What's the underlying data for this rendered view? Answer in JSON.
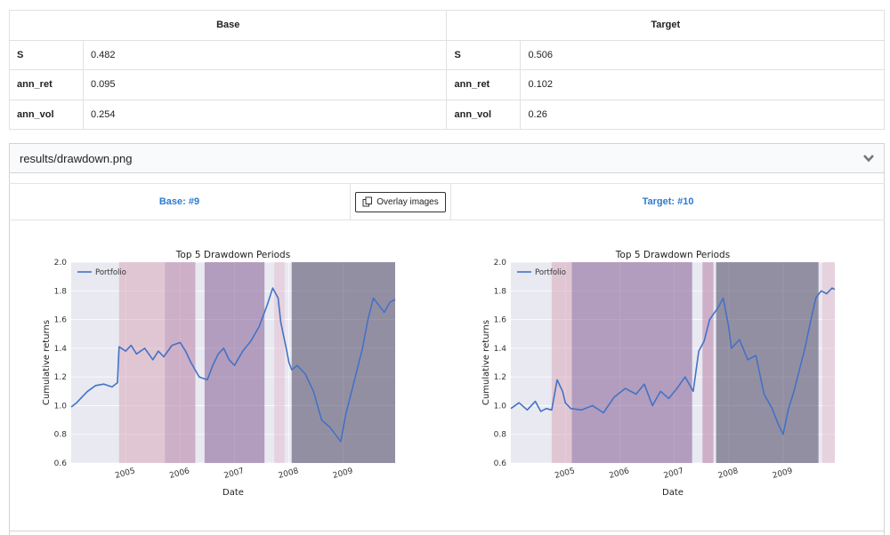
{
  "table": {
    "headers": {
      "base": "Base",
      "target": "Target"
    },
    "rows": [
      {
        "key": "S",
        "base": "0.482",
        "target": "0.506"
      },
      {
        "key": "ann_ret",
        "base": "0.095",
        "target": "0.102"
      },
      {
        "key": "ann_vol",
        "base": "0.254",
        "target": "0.26"
      }
    ]
  },
  "section": {
    "title": "results/drawdown.png",
    "base_label": "Base: #9",
    "target_label": "Target: #10",
    "overlay_button": "Overlay images",
    "link_color": "#2b7bd0"
  },
  "chart_data": [
    {
      "type": "line",
      "title": "Top 5 Drawdown Periods",
      "xlabel": "Date",
      "ylabel": "Cumulative returns",
      "ylim": [
        0.6,
        2.0
      ],
      "yticks": [
        "0.6",
        "0.8",
        "1.0",
        "1.2",
        "1.4",
        "1.6",
        "1.8",
        "2.0"
      ],
      "xticks": [
        "2005",
        "2006",
        "2007",
        "2008",
        "2009"
      ],
      "xrange": [
        2004.0,
        2009.95
      ],
      "legend": "top-left",
      "series": [
        {
          "name": "Portfolio",
          "color": "#4472c4",
          "x": [
            2004.0,
            2004.1,
            2004.2,
            2004.3,
            2004.45,
            2004.6,
            2004.75,
            2004.85,
            2004.88,
            2005.0,
            2005.1,
            2005.2,
            2005.35,
            2005.5,
            2005.6,
            2005.7,
            2005.85,
            2006.0,
            2006.1,
            2006.2,
            2006.35,
            2006.5,
            2006.6,
            2006.7,
            2006.8,
            2006.9,
            2007.0,
            2007.15,
            2007.3,
            2007.45,
            2007.6,
            2007.7,
            2007.8,
            2007.85,
            2007.95,
            2008.0,
            2008.05,
            2008.15,
            2008.3,
            2008.45,
            2008.6,
            2008.75,
            2008.85,
            2008.95,
            2009.05,
            2009.15,
            2009.25,
            2009.35,
            2009.45,
            2009.55,
            2009.65,
            2009.75,
            2009.85,
            2009.95
          ],
          "y": [
            0.99,
            1.02,
            1.06,
            1.1,
            1.14,
            1.15,
            1.13,
            1.16,
            1.41,
            1.38,
            1.42,
            1.36,
            1.4,
            1.32,
            1.38,
            1.34,
            1.42,
            1.44,
            1.38,
            1.3,
            1.2,
            1.18,
            1.28,
            1.36,
            1.4,
            1.32,
            1.28,
            1.38,
            1.45,
            1.55,
            1.7,
            1.82,
            1.75,
            1.58,
            1.4,
            1.3,
            1.25,
            1.28,
            1.22,
            1.1,
            0.9,
            0.85,
            0.8,
            0.75,
            0.95,
            1.1,
            1.25,
            1.4,
            1.6,
            1.75,
            1.7,
            1.65,
            1.72,
            1.74
          ]
        }
      ],
      "drawdowns": [
        {
          "start": 2004.88,
          "end": 2005.72,
          "color": "#d7a3b6",
          "alpha": 0.5
        },
        {
          "start": 2005.72,
          "end": 2006.28,
          "color": "#b67fa6",
          "alpha": 0.55
        },
        {
          "start": 2006.45,
          "end": 2007.55,
          "color": "#8d6a9d",
          "alpha": 0.6
        },
        {
          "start": 2007.73,
          "end": 2007.92,
          "color": "#e2bccb",
          "alpha": 0.5
        },
        {
          "start": 2008.05,
          "end": 2009.95,
          "color": "#5a5470",
          "alpha": 0.6
        }
      ]
    },
    {
      "type": "line",
      "title": "Top 5 Drawdown Periods",
      "xlabel": "Date",
      "ylabel": "Cumulative returns",
      "ylim": [
        0.6,
        2.0
      ],
      "yticks": [
        "0.6",
        "0.8",
        "1.0",
        "1.2",
        "1.4",
        "1.6",
        "1.8",
        "2.0"
      ],
      "xticks": [
        "2005",
        "2006",
        "2007",
        "2008",
        "2009"
      ],
      "xrange": [
        2004.0,
        2009.95
      ],
      "legend": "top-left",
      "series": [
        {
          "name": "Portfolio",
          "color": "#4472c4",
          "x": [
            2004.0,
            2004.15,
            2004.3,
            2004.45,
            2004.55,
            2004.65,
            2004.75,
            2004.85,
            2004.95,
            2005.0,
            2005.1,
            2005.3,
            2005.5,
            2005.7,
            2005.9,
            2006.1,
            2006.3,
            2006.45,
            2006.6,
            2006.75,
            2006.9,
            2007.05,
            2007.2,
            2007.35,
            2007.45,
            2007.55,
            2007.65,
            2007.8,
            2007.9,
            2008.0,
            2008.05,
            2008.2,
            2008.35,
            2008.5,
            2008.65,
            2008.8,
            2008.9,
            2009.0,
            2009.1,
            2009.2,
            2009.3,
            2009.4,
            2009.5,
            2009.6,
            2009.7,
            2009.8,
            2009.9,
            2009.95
          ],
          "y": [
            0.98,
            1.02,
            0.97,
            1.03,
            0.96,
            0.98,
            0.97,
            1.18,
            1.1,
            1.02,
            0.98,
            0.97,
            1.0,
            0.95,
            1.06,
            1.12,
            1.08,
            1.15,
            1.0,
            1.1,
            1.05,
            1.12,
            1.2,
            1.1,
            1.38,
            1.45,
            1.6,
            1.68,
            1.75,
            1.55,
            1.4,
            1.46,
            1.32,
            1.35,
            1.08,
            0.98,
            0.88,
            0.8,
            0.98,
            1.1,
            1.25,
            1.4,
            1.58,
            1.75,
            1.8,
            1.78,
            1.82,
            1.81
          ]
        }
      ],
      "drawdowns": [
        {
          "start": 2004.75,
          "end": 2005.12,
          "color": "#d7a3b6",
          "alpha": 0.5
        },
        {
          "start": 2005.12,
          "end": 2007.33,
          "color": "#8d6a9d",
          "alpha": 0.6
        },
        {
          "start": 2007.52,
          "end": 2007.72,
          "color": "#b67fa6",
          "alpha": 0.55
        },
        {
          "start": 2007.77,
          "end": 2009.65,
          "color": "#5a5470",
          "alpha": 0.6
        },
        {
          "start": 2009.72,
          "end": 2009.95,
          "color": "#e2bccb",
          "alpha": 0.5
        }
      ]
    }
  ]
}
